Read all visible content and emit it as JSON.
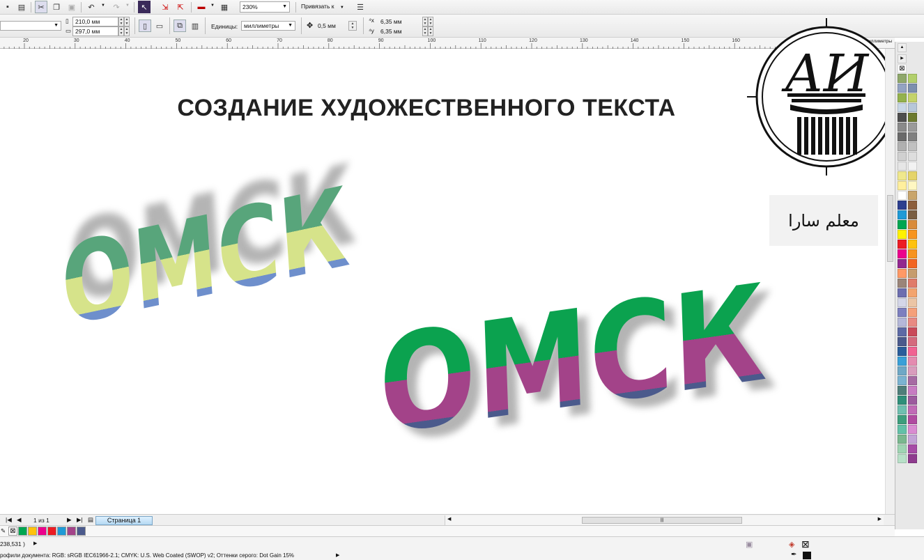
{
  "toolbar1": {
    "zoom_value": "230%",
    "snap_label": "Привязать к"
  },
  "toolbar2": {
    "width_value": "210,0 мм",
    "height_value": "297,0 мм",
    "units_label": "Единицы:",
    "units_value": "миллиметры",
    "nudge_value": "0,5 мм",
    "dup_x_value": "6,35 мм",
    "dup_y_value": "6,35 мм",
    "units_suffix": "миллиметры"
  },
  "ruler": {
    "labels": [
      "20",
      "30",
      "40",
      "50",
      "60",
      "70",
      "80",
      "90",
      "100",
      "110",
      "120",
      "130",
      "140",
      "150",
      "160"
    ]
  },
  "canvas": {
    "title": "СОЗДАНИЕ ХУДОЖЕСТВЕННОГО ТЕКСТА",
    "art_text": "ОМСК",
    "arabic_text": "معلم سارا",
    "logo_text": "АИ"
  },
  "colors": {
    "text1_top": "#58a57b",
    "text1_mid": "#d6e38a",
    "text1_bot": "#6e8fcc",
    "text2_top": "#0ba24f",
    "text2_mid": "#a34389",
    "text2_bot": "#4b5a8c"
  },
  "pagebar": {
    "page_count": "1 из 1",
    "page_tab": "Страница 1"
  },
  "status": {
    "coords": "238,531 )",
    "profiles": "рофили документа: RGB: sRGB IEC61966-2.1; CMYK: U.S. Web Coated (SWOP) v2; Оттенки серого: Dot Gain 15%"
  },
  "palette_colors": [
    "#8fa86b",
    "#b2cf6b",
    "#93a3c2",
    "#7c8fae",
    "#94b24d",
    "#c4d36a",
    "#c9d7e6",
    "#b7c7d9",
    "#4e4e4e",
    "#6c7a2f",
    "#8a8a8a",
    "#9a9a9a",
    "#6a6a6a",
    "#808080",
    "#b0b0b0",
    "#c0c0c0",
    "#d0d0d0",
    "#ddd",
    "#e6e6e6",
    "#f2f2f2",
    "#f0e88c",
    "#e5d46a",
    "#ffef9d",
    "#fff7c2",
    "#ffffff",
    "#c9a56b",
    "#2d3f8f",
    "#8c5e3c",
    "#1f9ad6",
    "#7a5e42",
    "#00a651",
    "#d98b3a",
    "#fff200",
    "#f7941d",
    "#ed1c24",
    "#ffc20e",
    "#ec008c",
    "#f7931e",
    "#92278f",
    "#f26522",
    "#ff9966",
    "#c69c6d",
    "#9b8579",
    "#e07b6a",
    "#6d6eaf",
    "#f3a46e",
    "#d4d6e8",
    "#ebc5a5",
    "#7d7fbf",
    "#f5a07a",
    "#b5b8d9",
    "#e88a83",
    "#5d6aa5",
    "#c94a5a",
    "#4b5a8c",
    "#d46a7e",
    "#2a5d9b",
    "#f06292",
    "#3aa0d8",
    "#e48bb0",
    "#6fa8c6",
    "#d99cbd",
    "#7bb3d1",
    "#a66aa3",
    "#4e7e7a",
    "#c77bc2",
    "#2f8f7a",
    "#9c5a9e",
    "#6fbfb0",
    "#c06ab6",
    "#3d9e7d",
    "#b04aa0",
    "#63c1a8",
    "#d98bd1",
    "#7ab88f",
    "#c2a3d6",
    "#9fd4b3",
    "#a64ca6",
    "#b8e0c8",
    "#8e3b8e"
  ]
}
